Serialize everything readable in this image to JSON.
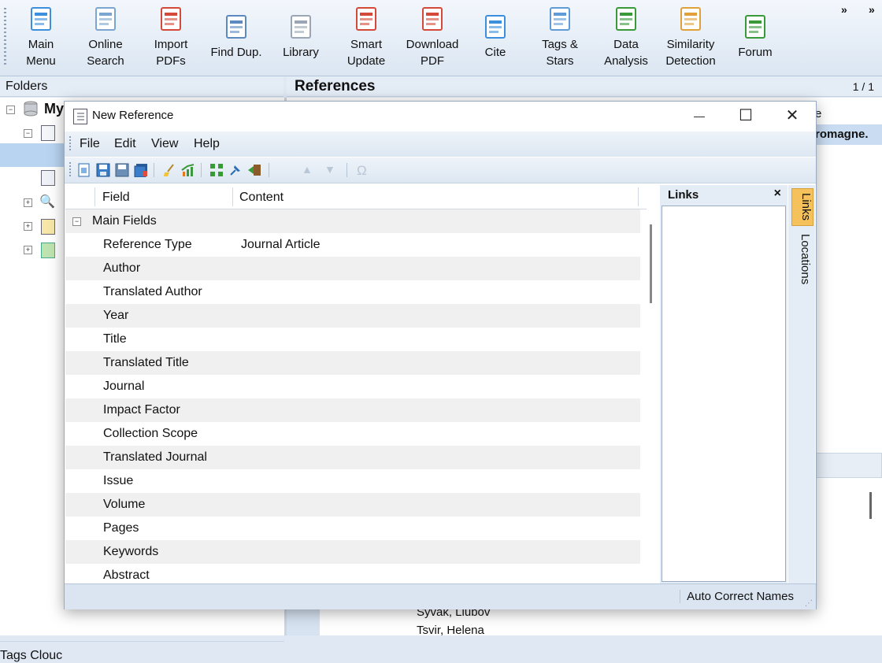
{
  "ribbon": {
    "buttons": [
      {
        "label1": "Main",
        "label2": "Menu",
        "icon": "main-menu-icon"
      },
      {
        "label1": "Online",
        "label2": "Search",
        "icon": "online-search-icon"
      },
      {
        "label1": "Import",
        "label2": "PDFs",
        "icon": "import-pdf-icon"
      },
      {
        "label1": "Find Dup.",
        "label2": "",
        "icon": "find-duplicates-icon"
      },
      {
        "label1": "Library",
        "label2": "",
        "icon": "library-icon"
      },
      {
        "label1": "Smart",
        "label2": "Update",
        "icon": "smart-update-icon"
      },
      {
        "label1": "Download",
        "label2": "PDF",
        "icon": "download-pdf-icon"
      },
      {
        "label1": "Cite",
        "label2": "",
        "icon": "cite-icon"
      },
      {
        "label1": "Tags &",
        "label2": "Stars",
        "icon": "tag-icon"
      },
      {
        "label1": "Data",
        "label2": "Analysis",
        "icon": "data-analysis-icon"
      },
      {
        "label1": "Similarity",
        "label2": "Detection",
        "icon": "similarity-detection-icon"
      },
      {
        "label1": "Forum",
        "label2": "",
        "icon": "forum-icon"
      }
    ],
    "overflow": "»"
  },
  "main": {
    "folders_label": "Folders",
    "references_label": "References",
    "page_indicator": "1 / 1",
    "tree_root": "My",
    "tags_cloud": "Tags Clouc",
    "ref_col_fragment": "e",
    "ref_row_fragment": "romagne.",
    "authors": [
      "Syvak, Liubov",
      "Tsvir, Helena"
    ]
  },
  "dialog": {
    "title": "New Reference",
    "minimize": "—",
    "maximize": "☐",
    "close": "✕",
    "menu": [
      "File",
      "Edit",
      "View",
      "Help"
    ],
    "grid": {
      "col_field": "Field",
      "col_content": "Content",
      "group": "Main Fields",
      "rows": [
        {
          "field": "Reference Type",
          "content": "Journal Article"
        },
        {
          "field": "Author",
          "content": ""
        },
        {
          "field": "Translated Author",
          "content": ""
        },
        {
          "field": "Year",
          "content": ""
        },
        {
          "field": "Title",
          "content": ""
        },
        {
          "field": "Translated Title",
          "content": ""
        },
        {
          "field": "Journal",
          "content": ""
        },
        {
          "field": "Impact Factor",
          "content": ""
        },
        {
          "field": "Collection Scope",
          "content": ""
        },
        {
          "field": "Translated Journal",
          "content": ""
        },
        {
          "field": "Issue",
          "content": ""
        },
        {
          "field": "Volume",
          "content": ""
        },
        {
          "field": "Pages",
          "content": ""
        },
        {
          "field": "Keywords",
          "content": ""
        },
        {
          "field": "Abstract",
          "content": ""
        }
      ]
    },
    "links_title": "Links",
    "links_close": "×",
    "side_tabs": [
      "Links",
      "Locations"
    ],
    "status": "Auto Correct Names"
  },
  "colors": {
    "ribbon_bg": "#dbe6f2",
    "selection": "#c9dcf1",
    "tab_active": "#f5c15a"
  }
}
